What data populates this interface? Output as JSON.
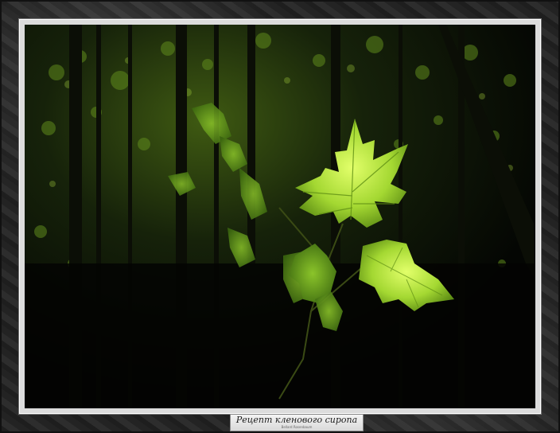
{
  "caption": {
    "title": "Рецепт кленового сиропа",
    "subtitle": "Bellard Rosenbaum"
  },
  "scene": {
    "subject": "sunlit-maple-leaves",
    "colors": {
      "background": "#050804",
      "leaf_light": "#c8f04a",
      "leaf_mid": "#7fb81f",
      "frame": "#2a2a2a",
      "mat": "#dcdcdc"
    }
  }
}
